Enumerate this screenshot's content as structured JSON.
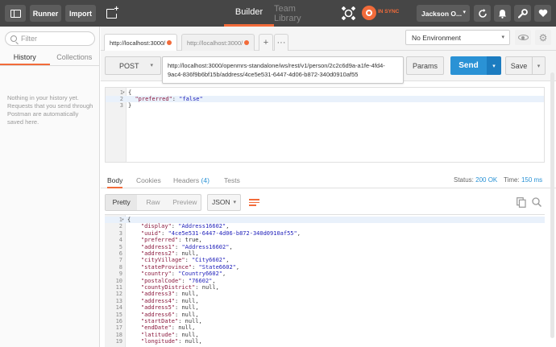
{
  "topbar": {
    "runner_label": "Runner",
    "import_label": "Import",
    "builder_label": "Builder",
    "team_library_label": "Team Library",
    "sync_label": "IN SYNC",
    "user_name": "Jackson O..."
  },
  "sidebar": {
    "filter_placeholder": "Filter",
    "tabs": [
      {
        "label": "History"
      },
      {
        "label": "Collections"
      }
    ],
    "empty_message": "Nothing in your history yet. Requests that you send through Postman are automatically saved here."
  },
  "request_tabs": [
    {
      "label": "http://localhost:3000/"
    },
    {
      "label": "http://localhost:3000/"
    }
  ],
  "environment": {
    "selected": "No Environment"
  },
  "request": {
    "method": "POST",
    "url": "http://localhost:3000/openmrs-standalone/ws/rest/v1/person/2c2c6d9a-a1fe-4fd4-9ac4-836f9b6bf15b/address/4ce5e531-6447-4d06-b872-340d0910af55",
    "params_label": "Params",
    "send_label": "Send",
    "save_label": "Save",
    "body_lines": [
      {
        "n": "1",
        "fold": "▾",
        "text": "{"
      },
      {
        "n": "2",
        "fold": "",
        "key": "\"preferred\"",
        "sep": ": ",
        "value": "\"false\""
      },
      {
        "n": "3",
        "fold": "",
        "text": "}"
      }
    ]
  },
  "response": {
    "tabs": {
      "body": "Body",
      "cookies": "Cookies",
      "headers": "Headers",
      "headers_count": "(4)",
      "tests": "Tests"
    },
    "status_label": "Status:",
    "status_value": "200 OK",
    "time_label": "Time:",
    "time_value": "150 ms",
    "view_options": [
      {
        "label": "Pretty"
      },
      {
        "label": "Raw"
      },
      {
        "label": "Preview"
      }
    ],
    "format": "JSON",
    "lines": [
      {
        "n": "1",
        "fold": "▾",
        "text": "{"
      },
      {
        "n": "2",
        "key": "\"display\"",
        "value": "\"Address16602\"",
        "vclass": "str"
      },
      {
        "n": "3",
        "key": "\"uuid\"",
        "value": "\"4ce5e531-6447-4d06-b872-340d0910af55\"",
        "vclass": "str"
      },
      {
        "n": "4",
        "key": "\"preferred\"",
        "value": "true",
        "vclass": "kw"
      },
      {
        "n": "5",
        "key": "\"address1\"",
        "value": "\"Address16602\"",
        "vclass": "str"
      },
      {
        "n": "6",
        "key": "\"address2\"",
        "value": "null",
        "vclass": "kw"
      },
      {
        "n": "7",
        "key": "\"cityVillage\"",
        "value": "\"City6602\"",
        "vclass": "str"
      },
      {
        "n": "8",
        "key": "\"stateProvince\"",
        "value": "\"State6602\"",
        "vclass": "str"
      },
      {
        "n": "9",
        "key": "\"country\"",
        "value": "\"Country6602\"",
        "vclass": "str"
      },
      {
        "n": "10",
        "key": "\"postalCode\"",
        "value": "\"76602\"",
        "vclass": "str"
      },
      {
        "n": "11",
        "key": "\"countyDistrict\"",
        "value": "null",
        "vclass": "kw"
      },
      {
        "n": "12",
        "key": "\"address3\"",
        "value": "null",
        "vclass": "kw"
      },
      {
        "n": "13",
        "key": "\"address4\"",
        "value": "null",
        "vclass": "kw"
      },
      {
        "n": "14",
        "key": "\"address5\"",
        "value": "null",
        "vclass": "kw"
      },
      {
        "n": "15",
        "key": "\"address6\"",
        "value": "null",
        "vclass": "kw"
      },
      {
        "n": "16",
        "key": "\"startDate\"",
        "value": "null",
        "vclass": "kw"
      },
      {
        "n": "17",
        "key": "\"endDate\"",
        "value": "null",
        "vclass": "kw"
      },
      {
        "n": "18",
        "key": "\"latitude\"",
        "value": "null",
        "vclass": "kw"
      },
      {
        "n": "19",
        "key": "\"longitude\"",
        "value": "null",
        "vclass": "kw"
      }
    ]
  },
  "colors": {
    "accent": "#f26b3a",
    "send": "#2a92d5",
    "topbar": "#464646"
  }
}
